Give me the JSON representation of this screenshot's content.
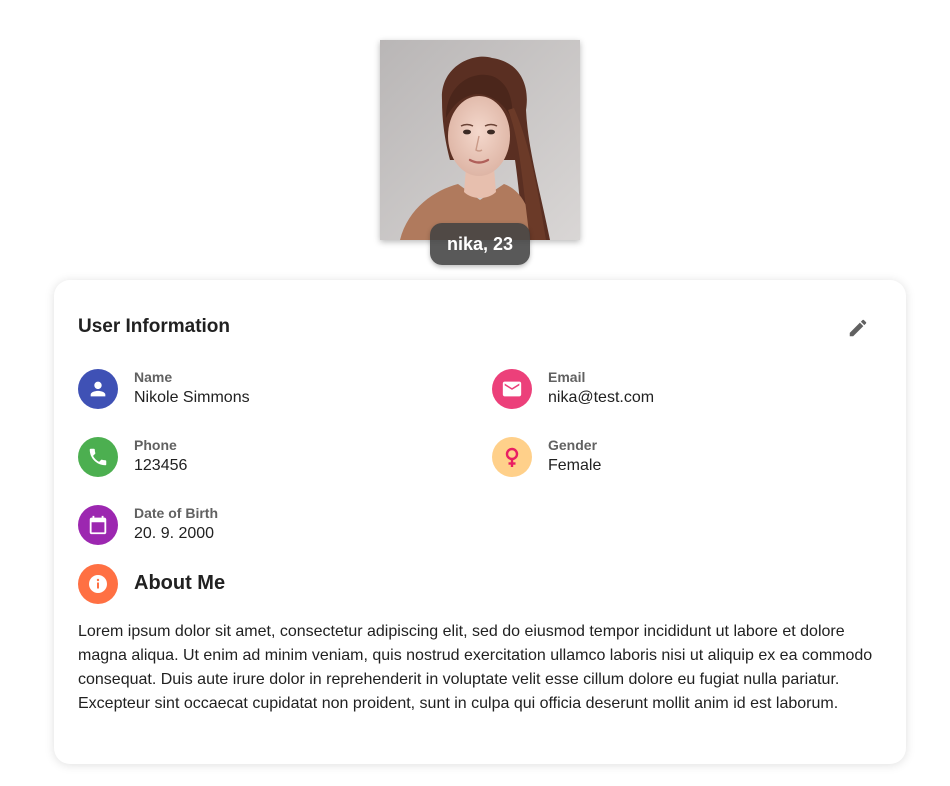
{
  "profile": {
    "name_age": "nika, 23"
  },
  "card": {
    "title": "User Information",
    "edit_icon": "pencil-icon"
  },
  "fields": {
    "name": {
      "label": "Name",
      "value": "Nikole Simmons",
      "icon": "person-icon",
      "color": "#3F51B5"
    },
    "email": {
      "label": "Email",
      "value": "nika@test.com",
      "icon": "mail-icon",
      "color": "#EC407A"
    },
    "phone": {
      "label": "Phone",
      "value": "123456",
      "icon": "phone-icon",
      "color": "#4CAF50"
    },
    "gender": {
      "label": "Gender",
      "value": "Female",
      "icon": "female-icon",
      "color": "#FFD08A",
      "icon_color": "#E91E63"
    },
    "dob": {
      "label": "Date of Birth",
      "value": "20. 9. 2000",
      "icon": "calendar-icon",
      "color": "#9C27B0"
    }
  },
  "about": {
    "title": "About Me",
    "icon": "info-icon",
    "color": "#FF7043",
    "text": "Lorem ipsum dolor sit amet, consectetur adipiscing elit, sed do eiusmod tempor incididunt ut labore et dolore magna aliqua. Ut enim ad minim veniam, quis nostrud exercitation ullamco laboris nisi ut aliquip ex ea commodo consequat. Duis aute irure dolor in reprehenderit in voluptate velit esse cillum dolore eu fugiat nulla pariatur. Excepteur sint occaecat cupidatat non proident, sunt in culpa qui officia deserunt mollit anim id est laborum."
  }
}
